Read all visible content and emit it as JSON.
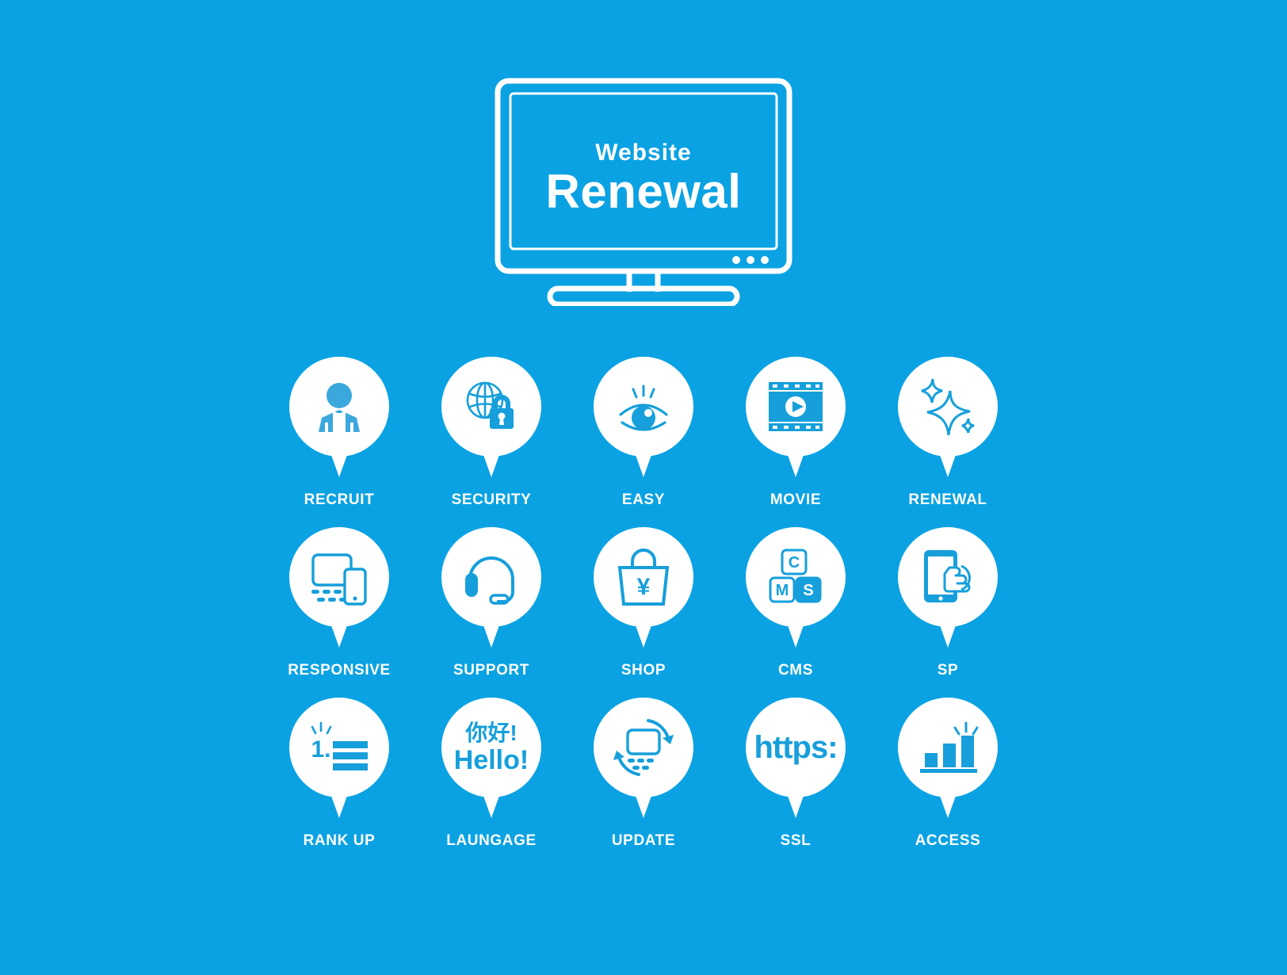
{
  "theme": {
    "background_color": "#0aa2e3",
    "foreground_color": "#ffffff",
    "icon_color": "#169fdb"
  },
  "hero": {
    "name": "monitor-illustration",
    "screen_title_small": "Website",
    "screen_title_large": "Renewal"
  },
  "icons": [
    {
      "id": "recruit",
      "label": "RECRUIT",
      "icon_name": "businessperson-icon"
    },
    {
      "id": "security",
      "label": "SECURITY",
      "icon_name": "globe-lock-icon"
    },
    {
      "id": "easy",
      "label": "EASY",
      "icon_name": "eye-icon"
    },
    {
      "id": "movie",
      "label": "MOVIE",
      "icon_name": "film-play-icon"
    },
    {
      "id": "renewal",
      "label": "RENEWAL",
      "icon_name": "sparkle-icon"
    },
    {
      "id": "responsive",
      "label": "RESPONSIVE",
      "icon_name": "laptop-phone-icon"
    },
    {
      "id": "support",
      "label": "SUPPORT",
      "icon_name": "headset-icon"
    },
    {
      "id": "shop",
      "label": "SHOP",
      "icon_name": "shopping-bag-yen-icon"
    },
    {
      "id": "cms",
      "label": "CMS",
      "icon_name": "cms-blocks-icon",
      "blocks": [
        "C",
        "M",
        "S"
      ]
    },
    {
      "id": "sp",
      "label": "SP",
      "icon_name": "smartphone-tap-icon"
    },
    {
      "id": "rankup",
      "label": "RANK UP",
      "icon_name": "rank-first-list-icon",
      "rank_text": "1."
    },
    {
      "id": "language",
      "label": "LAUNGAGE",
      "icon_name": "multilingual-greeting-icon",
      "greeting_cn": "你好!",
      "greeting_en": "Hello!"
    },
    {
      "id": "update",
      "label": "UPDATE",
      "icon_name": "laptop-refresh-icon"
    },
    {
      "id": "ssl",
      "label": "SSL",
      "icon_name": "https-text-icon",
      "https_text": "https:"
    },
    {
      "id": "access",
      "label": "ACCESS",
      "icon_name": "bar-chart-growth-icon"
    }
  ]
}
